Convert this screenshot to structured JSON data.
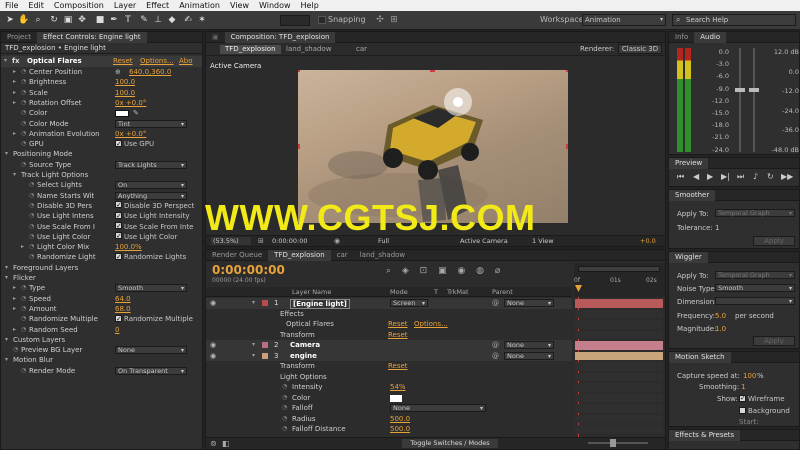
{
  "menu": [
    "File",
    "Edit",
    "Composition",
    "Layer",
    "Effect",
    "Animation",
    "View",
    "Window",
    "Help"
  ],
  "toolbar": {
    "snapping": "Snapping",
    "workspace_label": "Workspace:",
    "workspace_value": "Animation",
    "search_placeholder": "Search Help"
  },
  "left_panel": {
    "tabs": [
      "Project",
      "Effect Controls: Engine light"
    ],
    "subheader": "TFD_explosion • Engine light",
    "effect": {
      "name": "Optical Flares",
      "reset": "Reset",
      "options": "Options...",
      "about": "Abo"
    },
    "rows": [
      {
        "label": "Center Position",
        "value": "640.0,360.0"
      },
      {
        "label": "Brightness",
        "value": "100.0"
      },
      {
        "label": "Scale",
        "value": "100.0"
      },
      {
        "label": "Rotation Offset",
        "value": "0x +0.0°"
      },
      {
        "label": "Color",
        "value": ""
      },
      {
        "label": "Color Mode",
        "value": "Tint"
      },
      {
        "label": "Animation Evolution",
        "value": "0x +0.0°"
      },
      {
        "label": "GPU",
        "value": "Use GPU"
      },
      {
        "label": "Positioning Mode",
        "value": ""
      },
      {
        "label": "Source Type",
        "value": "Track Lights"
      },
      {
        "label": "Track Light Options",
        "value": ""
      },
      {
        "label": "Select Lights",
        "value": "On"
      },
      {
        "label": "Name Starts Wit",
        "value": "Anything"
      },
      {
        "label": "Disable 3D Pers",
        "value": "Disable 3D Perspect"
      },
      {
        "label": "Use Light Intens",
        "value": "Use Light Intensity"
      },
      {
        "label": "Use Scale From I",
        "value": "Use Scale From Inte"
      },
      {
        "label": "Use Light Color",
        "value": "Use Light Color"
      },
      {
        "label": "Light Color Mix",
        "value": "100.0%"
      },
      {
        "label": "Randomize Light",
        "value": "Randomize Lights"
      },
      {
        "label": "Foreground Layers",
        "value": ""
      },
      {
        "label": "Flicker",
        "value": ""
      },
      {
        "label": "Type",
        "value": "Smooth"
      },
      {
        "label": "Speed",
        "value": "64.0"
      },
      {
        "label": "Amount",
        "value": "68.0"
      },
      {
        "label": "Randomize Multiple",
        "value": "Randomize Multiple"
      },
      {
        "label": "Random Seed",
        "value": "0"
      },
      {
        "label": "Custom Layers",
        "value": ""
      },
      {
        "label": "Preview BG Layer",
        "value": "None"
      },
      {
        "label": "Motion Blur",
        "value": ""
      },
      {
        "label": "Render Mode",
        "value": "On Transparent"
      }
    ]
  },
  "comp": {
    "tab": "Composition: TFD_explosion",
    "subtabs": [
      "TFD_explosion",
      "land_shadow",
      "car"
    ],
    "renderer_label": "Renderer:",
    "renderer_value": "Classic 3D",
    "view_label": "Active Camera",
    "footer": {
      "zoom": "(53.5%)",
      "time": "0:00:00:00",
      "quality": "Full",
      "camera": "Active Camera",
      "views": "1 View",
      "exposure": "+0.0"
    }
  },
  "watermark": "WWW.CGTSJ.COM",
  "timeline": {
    "tabs": [
      "Render Queue",
      "TFD_explosion",
      "car",
      "land_shadow"
    ],
    "timecode": "0:00:00:00",
    "frames": "00000 (24.00 fps)",
    "columns": {
      "layer_name": "Layer Name",
      "mode": "Mode",
      "t": "T",
      "trkmat": "TrkMat",
      "parent": "Parent"
    },
    "ruler": [
      "0f",
      "01s",
      "02s"
    ],
    "rows": [
      {
        "num": "1",
        "name": "[Engine light]",
        "mode": "Screen",
        "parent": "None"
      },
      {
        "name": "Effects"
      },
      {
        "name": "Optical Flares",
        "reset": "Reset",
        "options": "Options..."
      },
      {
        "name": "Transform",
        "reset": "Reset"
      },
      {
        "num": "2",
        "name": "Camera",
        "parent": "None"
      },
      {
        "num": "3",
        "name": "engine",
        "parent": "None"
      },
      {
        "name": "Transform",
        "reset": "Reset"
      },
      {
        "name": "Light Options"
      },
      {
        "name": "Intensity",
        "value": "54%"
      },
      {
        "name": "Color",
        "value": ""
      },
      {
        "name": "Falloff",
        "value": "None"
      },
      {
        "name": "Radius",
        "value": "500.0"
      },
      {
        "name": "Falloff Distance",
        "value": "500.0"
      }
    ],
    "toggle": "Toggle Switches / Modes"
  },
  "info_panel": {
    "tabs": [
      "Info",
      "Audio"
    ],
    "db_left": [
      "0.0",
      "-3.0",
      "-6.0",
      "-9.0",
      "-12.0",
      "-15.0",
      "-18.0",
      "-21.0",
      "-24.0"
    ],
    "db_right": [
      "12.0 dB",
      "0.0",
      "-12.0",
      "-24.0",
      "-36.0",
      "-48.0 dB"
    ]
  },
  "preview": {
    "title": "Preview"
  },
  "smoother": {
    "title": "Smoother",
    "apply_to_label": "Apply To:",
    "apply_to_value": "Temporal Graph",
    "tolerance_label": "Tolerance:",
    "tolerance_value": "1",
    "apply": "Apply"
  },
  "wiggler": {
    "title": "Wiggler",
    "apply_to_label": "Apply To:",
    "apply_to_value": "Temporal Graph",
    "noise_label": "Noise Type:",
    "noise_value": "Smooth",
    "dimensions_label": "Dimensions:",
    "frequency_label": "Frequency:",
    "frequency_value": "5.0",
    "frequency_unit": "per second",
    "magnitude_label": "Magnitude:",
    "magnitude_value": "1.0",
    "apply": "Apply"
  },
  "motion_sketch": {
    "title": "Motion Sketch",
    "capture_label": "Capture speed at:",
    "capture_value": "100",
    "capture_unit": "%",
    "smoothing_label": "Smoothing:",
    "smoothing_value": "1",
    "show_label": "Show:",
    "wireframe": "Wireframe",
    "background": "Background",
    "start": "Start:"
  },
  "effects_presets": {
    "title": "Effects & Presets"
  }
}
